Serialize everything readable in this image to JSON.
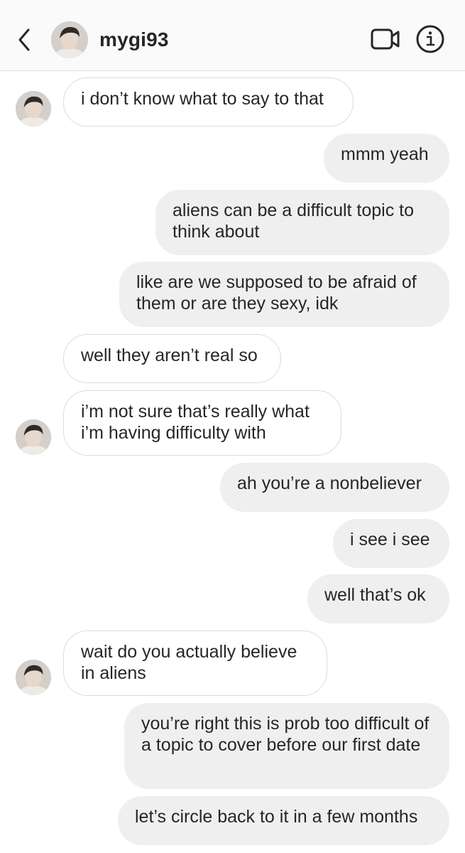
{
  "header": {
    "username": "mygi93",
    "back_icon": "chevron-left-icon",
    "video_icon": "video-camera-icon",
    "info_icon": "info-icon"
  },
  "messages": [
    {
      "from": "them",
      "text": "i don’t know what to say to that"
    },
    {
      "from": "me",
      "text": "mmm yeah"
    },
    {
      "from": "me",
      "text": "aliens can be a difficult topic to think about"
    },
    {
      "from": "me",
      "text": "like are we supposed to be afraid of them or are they sexy, idk"
    },
    {
      "from": "them",
      "text": "well they aren’t real so"
    },
    {
      "from": "them",
      "text": "i’m not sure that’s really what i’m having difficulty with"
    },
    {
      "from": "me",
      "text": "ah you’re a nonbeliever"
    },
    {
      "from": "me",
      "text": "i see i see"
    },
    {
      "from": "me",
      "text": "well that’s ok"
    },
    {
      "from": "them",
      "text": "wait do you actually believe in aliens"
    },
    {
      "from": "me",
      "text": "you’re right this is prob too difficult of a topic to cover before our first date"
    },
    {
      "from": "me",
      "text": "let’s circle back to it in a few months"
    }
  ],
  "colors": {
    "header_bg": "#fafafa",
    "sent_bubble": "#efefef",
    "received_border": "#dbdbdb",
    "text": "#262626"
  }
}
